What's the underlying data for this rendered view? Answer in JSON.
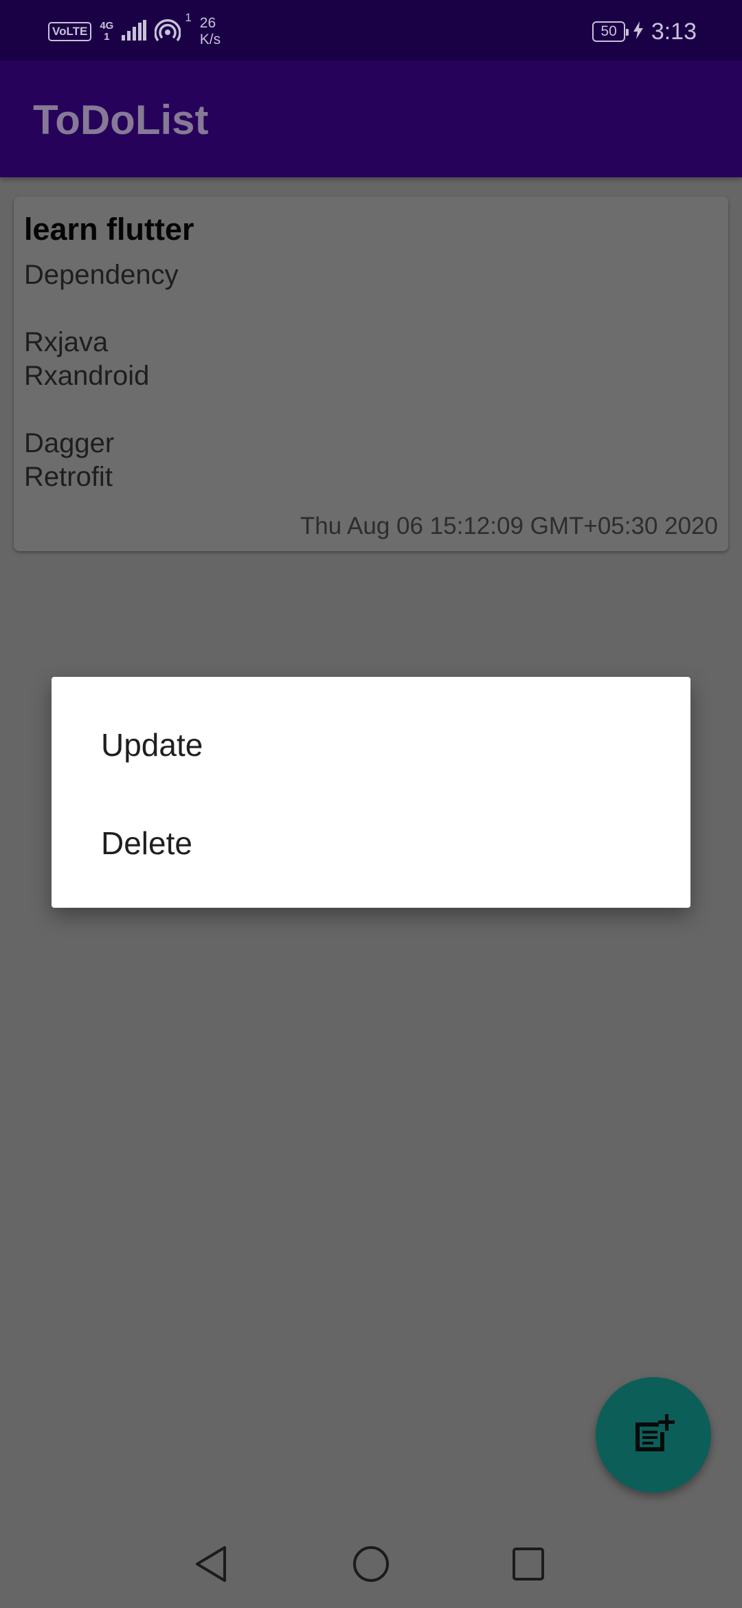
{
  "status_bar": {
    "volte": "VoLTE",
    "network": "4G",
    "network_sub": "1",
    "hotspot_count": "1",
    "speed_value": "26",
    "speed_unit": "K/s",
    "battery": "50",
    "time": "3:13"
  },
  "app_bar": {
    "title": "ToDoList"
  },
  "todo_card": {
    "title": "learn flutter",
    "body": "Dependency\n\nRxjava\nRxandroid\n\nDagger\nRetrofit",
    "date": "Thu Aug 06 15:12:09 GMT+05:30 2020"
  },
  "context_dialog": {
    "items": [
      {
        "label": "Update"
      },
      {
        "label": "Delete"
      }
    ]
  },
  "fab": {
    "icon": "note-add-icon",
    "color": "#0b5f58"
  },
  "colors": {
    "status_bar": "#1a0146",
    "app_bar": "#27025a",
    "scrim_background": "#666666",
    "dialog": "#ffffff"
  }
}
